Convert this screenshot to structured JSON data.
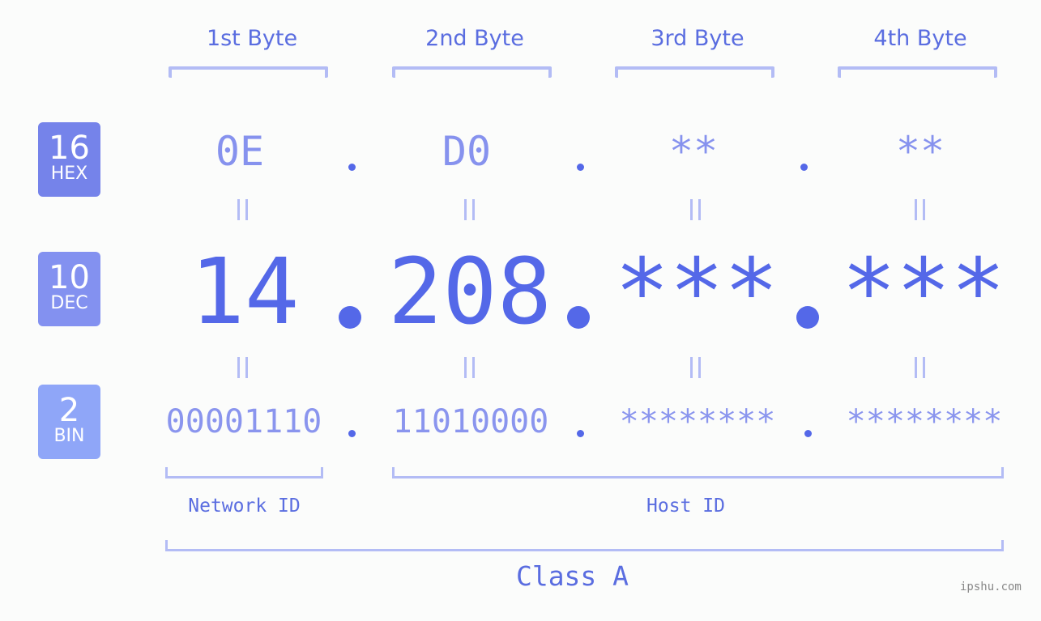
{
  "bytes": [
    {
      "label": "1st Byte",
      "hex": "0E",
      "dec": "14",
      "bin": "00001110"
    },
    {
      "label": "2nd Byte",
      "hex": "D0",
      "dec": "208",
      "bin": "11010000"
    },
    {
      "label": "3rd Byte",
      "hex": "**",
      "dec": "***",
      "bin": "********"
    },
    {
      "label": "4th Byte",
      "hex": "**",
      "dec": "***",
      "bin": "********"
    }
  ],
  "badges": {
    "hex": {
      "num": "16",
      "label": "HEX",
      "color": "#7583ea"
    },
    "dec": {
      "num": "10",
      "label": "DEC",
      "color": "#8391f0"
    },
    "bin": {
      "num": "2",
      "label": "BIN",
      "color": "#8fa6f8"
    }
  },
  "equals_symbol": "=",
  "network_id_label": "Network ID",
  "host_id_label": "Host ID",
  "class_label": "Class A",
  "watermark": "ipshu.com",
  "colors": {
    "accent": "#5468e8",
    "light_accent": "#b3bcf5",
    "hex_text": "#8692ee"
  }
}
